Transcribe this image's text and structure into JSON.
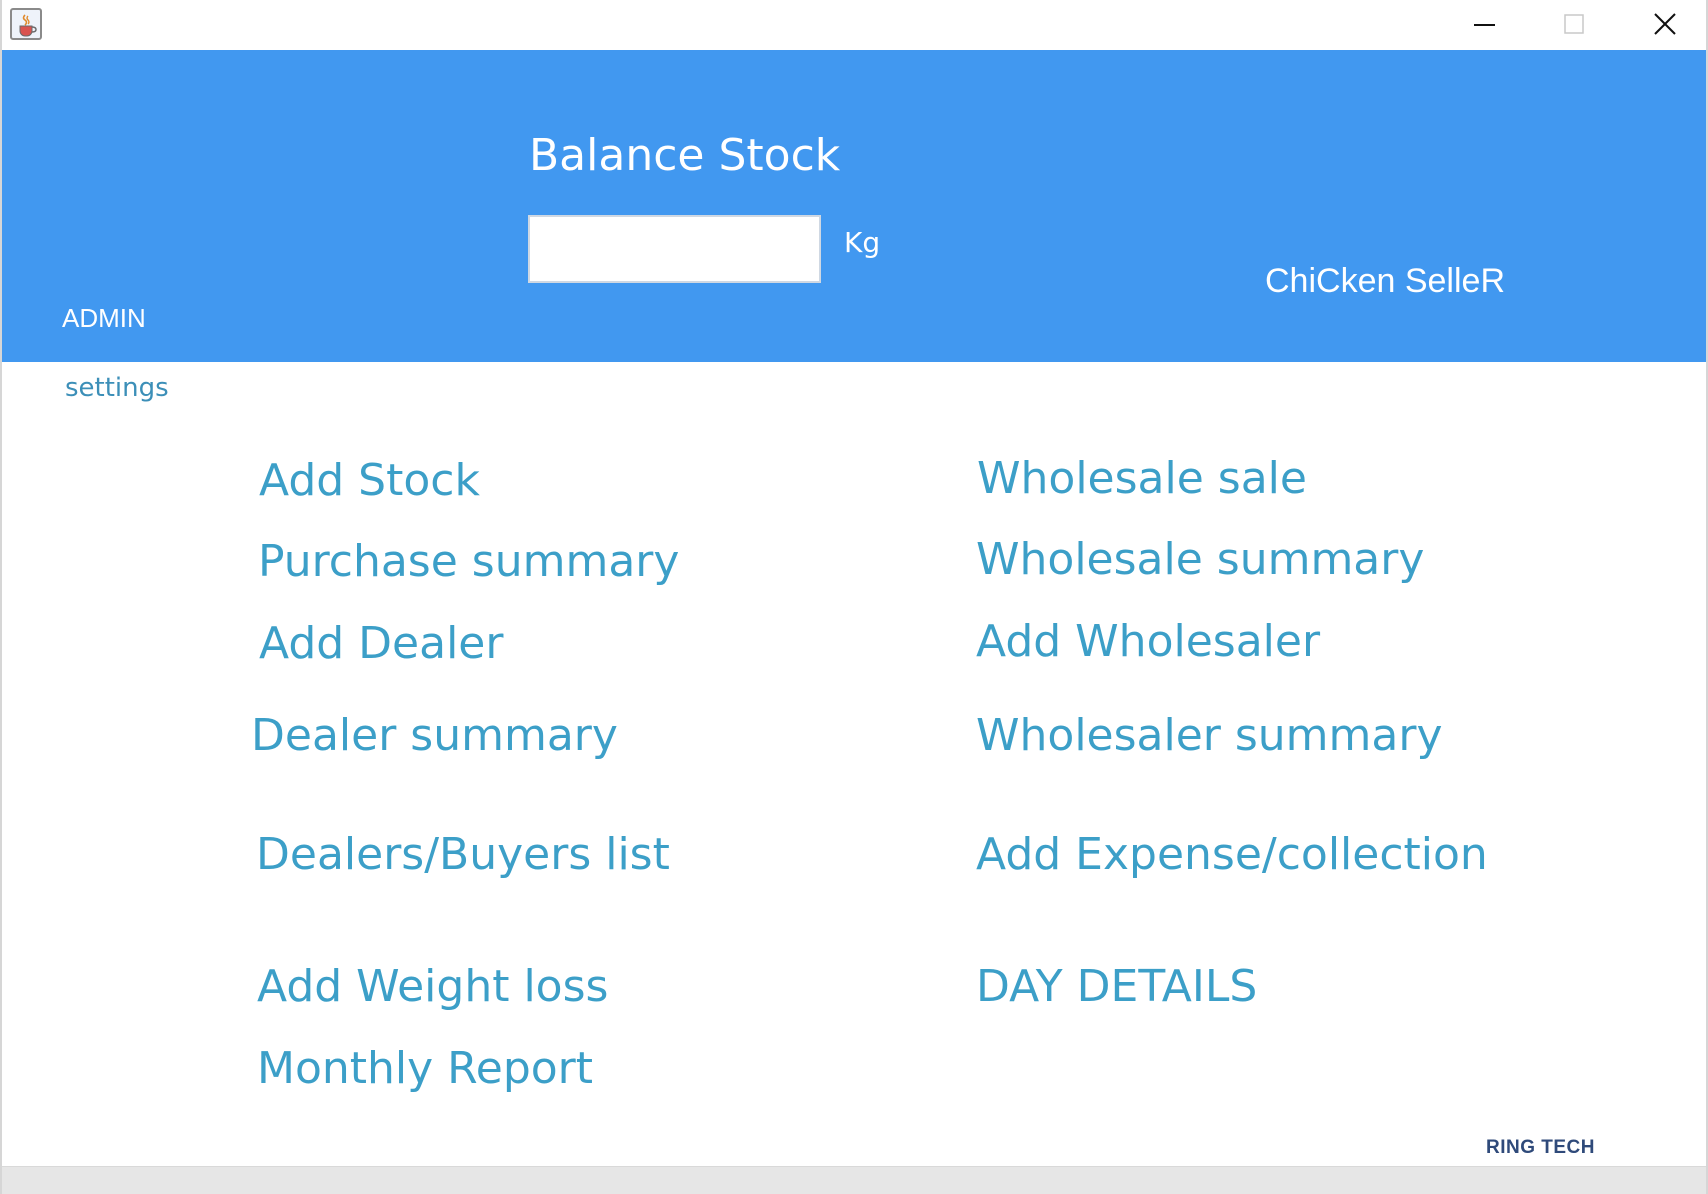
{
  "window": {
    "icons": {
      "app": "java-cup-icon",
      "minimize": "minimize-icon",
      "maximize": "maximize-icon",
      "close": "close-icon"
    }
  },
  "header": {
    "balance_title": "Balance Stock",
    "balance_value": "",
    "unit": "Kg",
    "brand": "ChiCken SelleR",
    "user": "ADMIN",
    "background_color": "#4198f0"
  },
  "settings_label": "settings",
  "menu": {
    "left": [
      "Add Stock",
      "Purchase summary",
      "Add Dealer",
      "Dealer summary",
      "Dealers/Buyers list",
      "Add Weight loss",
      "Monthly Report"
    ],
    "right": [
      "Wholesale sale",
      "Wholesale summary",
      "Add Wholesaler",
      "Wholesaler summary",
      "Add Expense/collection",
      "DAY DETAILS"
    ],
    "link_color": "#3c9fc8"
  },
  "footer": {
    "brand": "RING TECH"
  }
}
